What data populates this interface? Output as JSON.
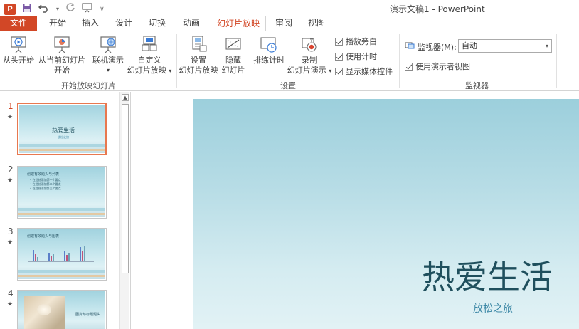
{
  "app": {
    "logo_letter": "P",
    "title": "演示文稿1 - PowerPoint"
  },
  "qat": {
    "save_icon": "floppy-disk-icon",
    "undo_icon": "undo-icon",
    "redo_icon": "redo-icon",
    "present_icon": "start-from-beginning-icon",
    "more_icon": "customize-qat-icon"
  },
  "tabs": [
    {
      "label": "文件"
    },
    {
      "label": "开始"
    },
    {
      "label": "插入"
    },
    {
      "label": "设计"
    },
    {
      "label": "切换"
    },
    {
      "label": "动画"
    },
    {
      "label": "幻灯片放映"
    },
    {
      "label": "审阅"
    },
    {
      "label": "视图"
    }
  ],
  "ribbon": {
    "start_group": {
      "label": "开始放映幻灯片",
      "from_beginning": "从头开始",
      "from_current_1": "从当前幻灯片",
      "from_current_2": "开始",
      "online_present": "联机演示",
      "custom_1": "自定义",
      "custom_2": "幻灯片放映"
    },
    "setup_group": {
      "label": "设置",
      "setup_1": "设置",
      "setup_2": "幻灯片放映",
      "hide_1": "隐藏",
      "hide_2": "幻灯片",
      "rehearse": "排练计时",
      "record_1": "录制",
      "record_2": "幻灯片演示",
      "play_narration": "播放旁白",
      "use_timings": "使用计时",
      "show_media_controls": "显示媒体控件"
    },
    "monitor_group": {
      "label": "监视器",
      "monitor_label": "监视器(M):",
      "monitor_value": "自动",
      "presenter_view": "使用演示者视图"
    }
  },
  "slides": [
    {
      "number": "1",
      "title": "热爱生活",
      "subtitle": "放松之旅"
    },
    {
      "number": "2",
      "title": "创建有效题头与列表",
      "bullets": [
        "• 在此处添加第一个要点",
        "• 在此处添加第二个要点",
        "• 在此处添加第三个要点"
      ]
    },
    {
      "number": "3",
      "title": "创建有效题头与图表"
    },
    {
      "number": "4",
      "title": "图片与标题题头"
    }
  ],
  "main_slide": {
    "title": "热爱生活",
    "subtitle": "放松之旅"
  },
  "colors": {
    "accent": "#d24726",
    "slide_title": "#1f4f5d",
    "slide_subtitle": "#3d88a6"
  }
}
